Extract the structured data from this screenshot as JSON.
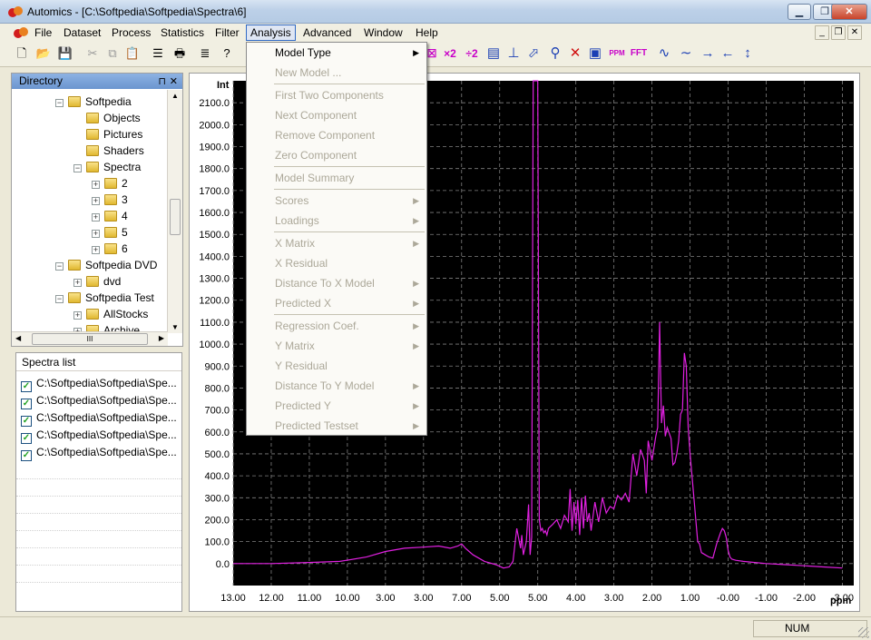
{
  "window": {
    "title": "Automics - [C:\\Softpedia\\Softpedia\\Spectra\\6]",
    "minimize": "0",
    "restore": "1",
    "close": "r"
  },
  "menubar": {
    "items": [
      "File",
      "Dataset",
      "Process",
      "Statistics",
      "Filter",
      "Analysis",
      "Advanced",
      "Window",
      "Help"
    ]
  },
  "toolbar": {
    "x2": "×2",
    "div2": "÷2",
    "ppm": "PPM",
    "fft": "FFT"
  },
  "directory": {
    "title": "Directory",
    "nodes": [
      {
        "label": "Softpedia",
        "expander": "−"
      },
      {
        "label": "Objects"
      },
      {
        "label": "Pictures"
      },
      {
        "label": "Shaders"
      },
      {
        "label": "Spectra",
        "expander": "−"
      },
      {
        "label": "2",
        "expander": "+"
      },
      {
        "label": "3",
        "expander": "+"
      },
      {
        "label": "4",
        "expander": "+"
      },
      {
        "label": "5",
        "expander": "+"
      },
      {
        "label": "6",
        "expander": "+"
      },
      {
        "label": "Softpedia DVD",
        "expander": "−"
      },
      {
        "label": "dvd",
        "expander": "+"
      },
      {
        "label": "Softpedia Test",
        "expander": "−"
      },
      {
        "label": "AllStocks",
        "expander": "+"
      },
      {
        "label": "Archive",
        "expander": "+"
      }
    ],
    "hscroll_thumb": "III"
  },
  "spectra_list": {
    "title": "Spectra list",
    "items": [
      "C:\\Softpedia\\Softpedia\\Spe...",
      "C:\\Softpedia\\Softpedia\\Spe...",
      "C:\\Softpedia\\Softpedia\\Spe...",
      "C:\\Softpedia\\Softpedia\\Spe...",
      "C:\\Softpedia\\Softpedia\\Spe..."
    ]
  },
  "analysis_menu": {
    "groups": [
      [
        {
          "label": "Model Type",
          "enabled": true,
          "submenu": true
        },
        {
          "label": "New Model ...",
          "enabled": false
        }
      ],
      [
        {
          "label": "First Two Components",
          "enabled": false
        },
        {
          "label": "Next Component",
          "enabled": false
        },
        {
          "label": "Remove Component",
          "enabled": false
        },
        {
          "label": "Zero Component",
          "enabled": false
        }
      ],
      [
        {
          "label": "Model Summary",
          "enabled": false
        }
      ],
      [
        {
          "label": "Scores",
          "enabled": false,
          "submenu": true
        },
        {
          "label": "Loadings",
          "enabled": false,
          "submenu": true
        }
      ],
      [
        {
          "label": "X Matrix",
          "enabled": false,
          "submenu": true
        },
        {
          "label": "X Residual",
          "enabled": false
        },
        {
          "label": "Distance To X Model",
          "enabled": false,
          "submenu": true
        },
        {
          "label": "Predicted X",
          "enabled": false,
          "submenu": true
        }
      ],
      [
        {
          "label": "Regression Coef.",
          "enabled": false,
          "submenu": true
        },
        {
          "label": "Y Matrix",
          "enabled": false,
          "submenu": true
        },
        {
          "label": "Y Residual",
          "enabled": false
        },
        {
          "label": "Distance To Y Model",
          "enabled": false,
          "submenu": true
        },
        {
          "label": "Predicted Y",
          "enabled": false,
          "submenu": true
        },
        {
          "label": "Predicted Testset",
          "enabled": false,
          "submenu": true
        }
      ]
    ]
  },
  "status": {
    "num": "NUM"
  },
  "chart_data": {
    "type": "line",
    "ylabel": "Int",
    "xlabel": "ppm",
    "colors": {
      "background": "#000000",
      "line": "#e020e0",
      "grid": "#808080"
    },
    "x_tick_labels": [
      "13.00",
      "12.00",
      "11.00",
      "10.00",
      "3.00",
      "3.00",
      "7.00",
      "5.00",
      "5.00",
      "4.00",
      "3.00",
      "2.00",
      "1.00",
      "-0.00",
      "-1.00",
      "-2.00",
      "-3.00"
    ],
    "y_ticks": [
      "0.0",
      "100.0",
      "200.0",
      "300.0",
      "400.0",
      "500.0",
      "600.0",
      "700.0",
      "800.0",
      "900.0",
      "1000.0",
      "1100.0",
      "1200.0",
      "1300.0",
      "1400.0",
      "1500.0",
      "1600.0",
      "1700.0",
      "1800.0",
      "1900.0",
      "2000.0",
      "2100.0"
    ],
    "ylim": [
      -100,
      2200
    ],
    "xlim_ppm": [
      13.0,
      -3.3
    ],
    "grid": true,
    "series": [
      {
        "x": [
          13.0,
          12.0,
          11.0,
          10.2,
          9.5,
          9.0,
          8.5,
          8.0,
          7.6,
          7.3,
          7.1,
          7.0,
          6.9,
          6.7,
          6.4,
          6.1,
          5.9,
          5.75,
          5.65,
          5.55,
          5.45,
          5.42,
          5.38,
          5.3,
          5.24,
          5.2,
          5.16,
          5.12,
          5.08,
          5.04,
          5.0,
          4.96,
          4.92,
          4.88,
          4.84,
          4.8,
          4.76,
          4.72,
          4.6,
          4.5,
          4.4,
          4.3,
          4.2,
          4.15,
          4.1,
          4.05,
          4.0,
          3.95,
          3.9,
          3.85,
          3.8,
          3.75,
          3.7,
          3.65,
          3.6,
          3.5,
          3.4,
          3.3,
          3.2,
          3.1,
          3.0,
          2.9,
          2.8,
          2.7,
          2.6,
          2.5,
          2.4,
          2.3,
          2.2,
          2.15,
          2.1,
          2.0,
          1.9,
          1.85,
          1.8,
          1.75,
          1.7,
          1.65,
          1.6,
          1.5,
          1.45,
          1.4,
          1.35,
          1.3,
          1.25,
          1.2,
          1.15,
          1.1,
          1.05,
          1.0,
          0.95,
          0.9,
          0.85,
          0.8,
          0.75,
          0.7,
          0.6,
          0.5,
          0.4,
          0.3,
          0.2,
          0.15,
          0.1,
          0.05,
          0.0,
          -0.05,
          -0.1,
          -0.2,
          -0.4,
          -0.7,
          -1.0,
          -1.5,
          -2.0,
          -2.5,
          -3.0
        ],
        "y": [
          0,
          0,
          5,
          10,
          30,
          55,
          70,
          75,
          80,
          70,
          80,
          90,
          70,
          40,
          10,
          -5,
          -20,
          -15,
          10,
          160,
          70,
          130,
          40,
          100,
          270,
          40,
          120,
          2200,
          2200,
          2200,
          2200,
          200,
          150,
          160,
          140,
          150,
          130,
          160,
          180,
          200,
          160,
          220,
          190,
          340,
          150,
          280,
          180,
          290,
          130,
          300,
          160,
          310,
          190,
          230,
          150,
          280,
          190,
          300,
          230,
          260,
          250,
          310,
          290,
          320,
          280,
          500,
          400,
          520,
          470,
          320,
          560,
          470,
          580,
          620,
          1100,
          640,
          720,
          580,
          620,
          570,
          450,
          460,
          500,
          560,
          680,
          700,
          960,
          900,
          620,
          500,
          400,
          300,
          200,
          100,
          90,
          50,
          40,
          30,
          25,
          90,
          140,
          160,
          150,
          120,
          60,
          30,
          20,
          15,
          10,
          5,
          0,
          -5,
          -10,
          -15,
          -20
        ]
      }
    ]
  }
}
